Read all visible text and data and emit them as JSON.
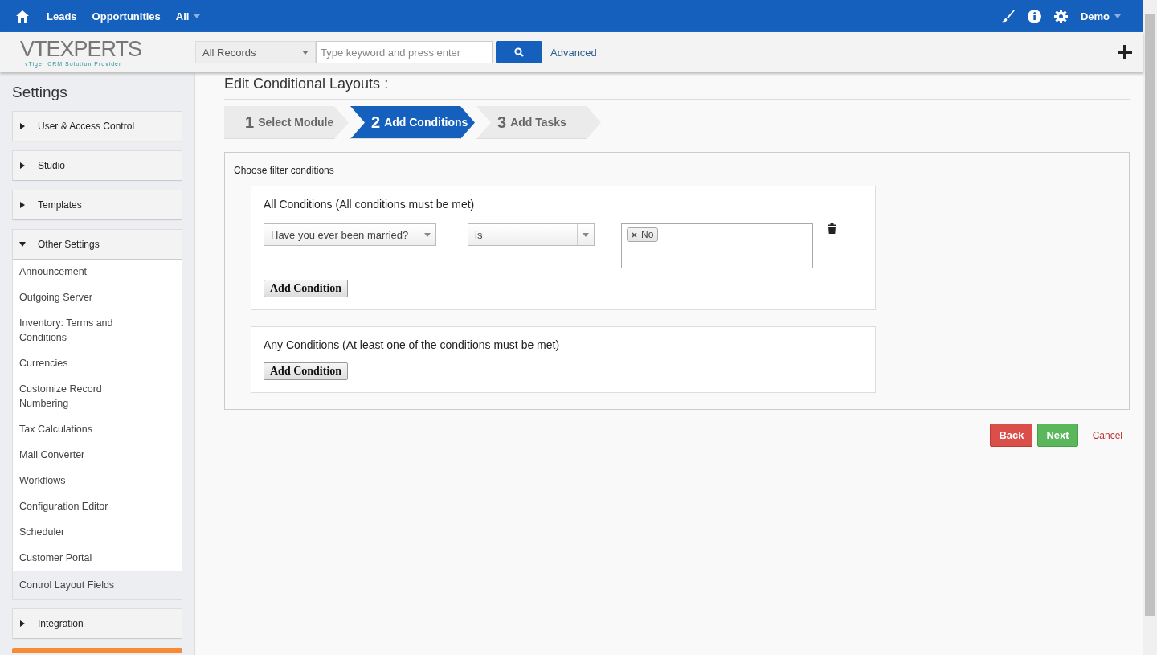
{
  "topbar": {
    "nav": [
      {
        "label": "Leads"
      },
      {
        "label": "Opportunities"
      },
      {
        "label": "All",
        "dropdown": true
      }
    ],
    "user": "Demo"
  },
  "searchbar": {
    "logo": "VTEXPERTS",
    "logo_tagline": "vTiger CRM Solution Provider",
    "scope": "All Records",
    "placeholder": "Type keyword and press enter",
    "advanced": "Advanced"
  },
  "sidebar": {
    "title": "Settings",
    "sections": [
      {
        "label": "User & Access Control",
        "expanded": false
      },
      {
        "label": "Studio",
        "expanded": false
      },
      {
        "label": "Templates",
        "expanded": false
      },
      {
        "label": "Other Settings",
        "expanded": true,
        "items": [
          {
            "label": "Announcement",
            "selected": false
          },
          {
            "label": "Outgoing Server",
            "selected": false
          },
          {
            "label": "Inventory: Terms and Conditions",
            "selected": false
          },
          {
            "label": "Currencies",
            "selected": false
          },
          {
            "label": "Customize Record Numbering",
            "selected": false
          },
          {
            "label": "Tax Calculations",
            "selected": false
          },
          {
            "label": "Mail Converter",
            "selected": false
          },
          {
            "label": "Workflows",
            "selected": false
          },
          {
            "label": "Configuration Editor",
            "selected": false
          },
          {
            "label": "Scheduler",
            "selected": false
          },
          {
            "label": "Customer Portal",
            "selected": false
          },
          {
            "label": "Control Layout Fields",
            "selected": true
          }
        ]
      },
      {
        "label": "Integration",
        "expanded": false
      }
    ]
  },
  "page": {
    "title": "Edit Conditional Layouts :",
    "steps": [
      {
        "number": "1",
        "label": "Select Module",
        "selected": false
      },
      {
        "number": "2",
        "label": "Add Conditions",
        "selected": true
      },
      {
        "number": "3",
        "label": "Add Tasks",
        "selected": false
      }
    ],
    "filter_label": "Choose filter conditions",
    "groups": [
      {
        "title": "All Conditions",
        "note": "(All conditions must be met)",
        "conditions": [
          {
            "field": "Have you ever been married?",
            "operator": "is",
            "values": [
              "No"
            ]
          }
        ],
        "button": "Add Condition"
      },
      {
        "title": "Any Conditions",
        "note": "(At least one of the conditions must be met)",
        "button": "Add Condition"
      }
    ],
    "buttons": {
      "back": "Back",
      "next": "Next",
      "cancel": "Cancel"
    }
  }
}
